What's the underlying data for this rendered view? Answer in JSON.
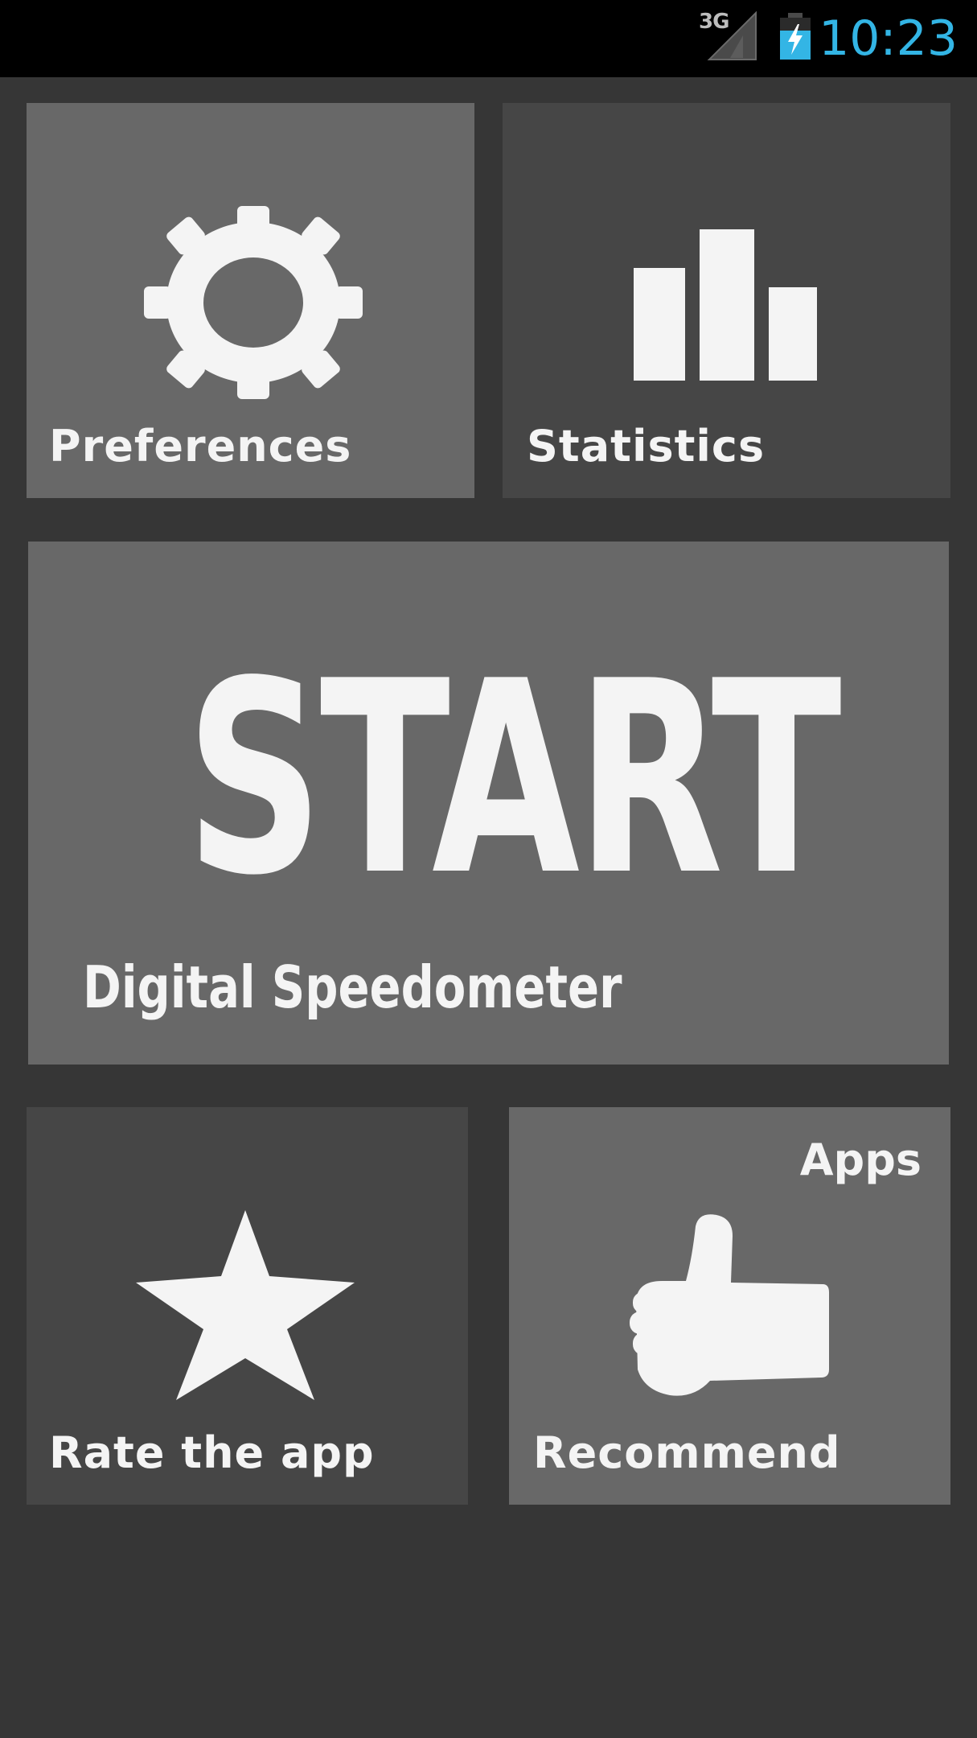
{
  "status_bar": {
    "network": "3G",
    "time": "10:23"
  },
  "tiles": {
    "preferences": {
      "label": "Preferences",
      "icon": "gear-icon"
    },
    "statistics": {
      "label": "Statistics",
      "icon": "bar-chart-icon"
    },
    "start": {
      "label": "START",
      "subtitle": "Digital Speedometer"
    },
    "rate": {
      "label": "Rate the app",
      "icon": "star-icon"
    },
    "recommend": {
      "label": "Recommend",
      "corner_label": "Apps",
      "icon": "thumbs-up-icon"
    }
  },
  "colors": {
    "background": "#363636",
    "tile_light": "#686868",
    "tile_dark": "#464646",
    "text": "#f4f4f4",
    "clock": "#33b5e5"
  }
}
